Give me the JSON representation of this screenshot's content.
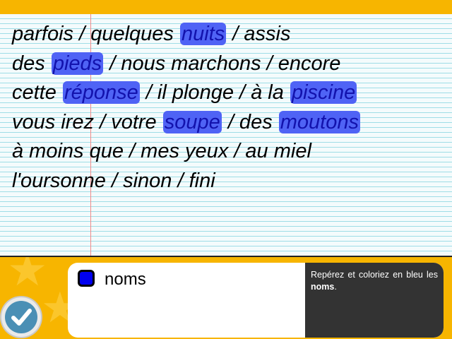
{
  "sentences": [
    [
      {
        "text": "parfois / quelques ",
        "hl": false
      },
      {
        "text": "nuits",
        "hl": true
      },
      {
        "text": " / assis",
        "hl": false
      }
    ],
    [
      {
        "text": "des ",
        "hl": false
      },
      {
        "text": "pieds",
        "hl": true
      },
      {
        "text": " / nous marchons / encore",
        "hl": false
      }
    ],
    [
      {
        "text": "cette ",
        "hl": false
      },
      {
        "text": "réponse",
        "hl": true
      },
      {
        "text": " / il plonge / à la ",
        "hl": false
      },
      {
        "text": "piscine",
        "hl": true
      }
    ],
    [
      {
        "text": "vous irez / votre ",
        "hl": false
      },
      {
        "text": "soupe",
        "hl": true
      },
      {
        "text": " / des ",
        "hl": false
      },
      {
        "text": "moutons",
        "hl": true
      }
    ],
    [
      {
        "text": "à moins que / mes yeux / au miel",
        "hl": false
      }
    ],
    [
      {
        "text": "l'oursonne / sinon / fini",
        "hl": false
      }
    ]
  ],
  "legend": {
    "label": "noms",
    "color": "#0000f0"
  },
  "instruction": {
    "before": "Repérez et coloriez en bleu les ",
    "bold": "noms",
    "after": "."
  },
  "colors": {
    "highlight": "#4f63f5",
    "background": "#f7b500"
  },
  "icons": {
    "validate": "checkmark-icon"
  }
}
